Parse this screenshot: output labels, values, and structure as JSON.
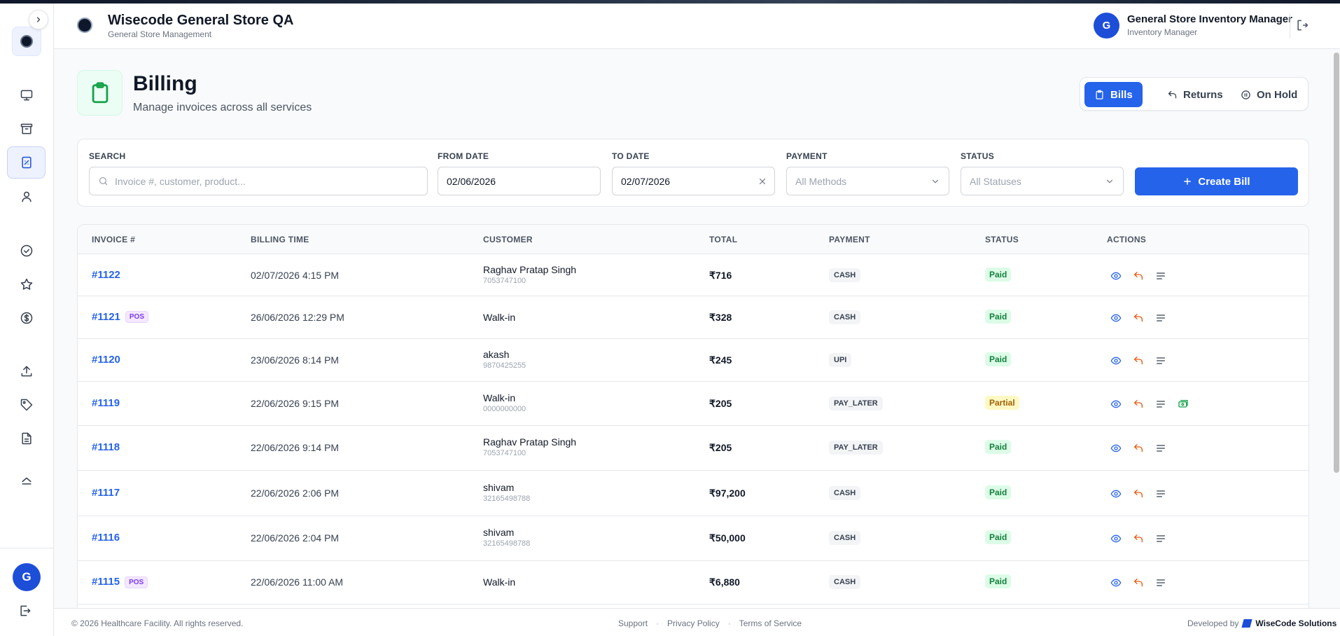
{
  "header": {
    "store_name": "Wisecode General Store QA",
    "store_subtitle": "General Store Management",
    "avatar_initial": "G",
    "user_name": "General Store Inventory Manager",
    "user_role": "Inventory Manager"
  },
  "sidebar": {
    "avatar_initial": "G",
    "items": [
      {
        "icon": "monitor-icon",
        "active": false
      },
      {
        "icon": "archive-icon",
        "active": false
      },
      {
        "icon": "receipt-icon",
        "active": true
      },
      {
        "icon": "user-icon",
        "active": false
      },
      {
        "icon": "check-circle-icon",
        "active": false
      },
      {
        "icon": "star-icon",
        "active": false
      },
      {
        "icon": "dollar-circle-icon",
        "active": false
      },
      {
        "icon": "upload-icon",
        "active": false
      },
      {
        "icon": "tag-icon",
        "active": false
      },
      {
        "icon": "document-icon",
        "active": false
      },
      {
        "icon": "eject-icon",
        "active": false
      }
    ]
  },
  "page": {
    "title": "Billing",
    "subtitle": "Manage invoices across all services",
    "tabs": [
      {
        "label": "Bills",
        "icon": "clipboard-icon",
        "active": true
      },
      {
        "label": "Returns",
        "icon": "return-icon",
        "active": false
      },
      {
        "label": "On Hold",
        "icon": "pause-icon",
        "active": false
      }
    ]
  },
  "filters": {
    "search_label": "SEARCH",
    "search_placeholder": "Invoice #, customer, product...",
    "from_label": "FROM DATE",
    "from_value": "02/06/2026",
    "to_label": "TO DATE",
    "to_value": "02/07/2026",
    "payment_label": "PAYMENT",
    "payment_value": "All Methods",
    "status_label": "STATUS",
    "status_value": "All Statuses",
    "create_label": "Create Bill"
  },
  "table": {
    "columns": [
      "INVOICE #",
      "BILLING TIME",
      "CUSTOMER",
      "TOTAL",
      "PAYMENT",
      "STATUS",
      "ACTIONS"
    ],
    "rows": [
      {
        "invoice": "#1122",
        "pos": false,
        "time": "02/07/2026 4:15 PM",
        "customer": "Raghav Pratap Singh",
        "phone": "7053747100",
        "total": "₹716",
        "payment": "CASH",
        "status": "Paid",
        "extra_action": false
      },
      {
        "invoice": "#1121",
        "pos": true,
        "pos_label": "POS",
        "time": "26/06/2026 12:29 PM",
        "customer": "Walk-in",
        "phone": "",
        "total": "₹328",
        "payment": "CASH",
        "status": "Paid",
        "extra_action": false
      },
      {
        "invoice": "#1120",
        "pos": false,
        "time": "23/06/2026 8:14 PM",
        "customer": "akash",
        "phone": "9870425255",
        "total": "₹245",
        "payment": "UPI",
        "status": "Paid",
        "extra_action": false
      },
      {
        "invoice": "#1119",
        "pos": false,
        "time": "22/06/2026 9:15 PM",
        "customer": "Walk-in",
        "phone": "0000000000",
        "total": "₹205",
        "payment": "PAY_LATER",
        "status": "Partial",
        "extra_action": true
      },
      {
        "invoice": "#1118",
        "pos": false,
        "time": "22/06/2026 9:14 PM",
        "customer": "Raghav Pratap Singh",
        "phone": "7053747100",
        "total": "₹205",
        "payment": "PAY_LATER",
        "status": "Paid",
        "extra_action": false
      },
      {
        "invoice": "#1117",
        "pos": false,
        "time": "22/06/2026 2:06 PM",
        "customer": "shivam",
        "phone": "32165498788",
        "total": "₹97,200",
        "payment": "CASH",
        "status": "Paid",
        "extra_action": false
      },
      {
        "invoice": "#1116",
        "pos": false,
        "time": "22/06/2026 2:04 PM",
        "customer": "shivam",
        "phone": "32165498788",
        "total": "₹50,000",
        "payment": "CASH",
        "status": "Paid",
        "extra_action": false
      },
      {
        "invoice": "#1115",
        "pos": true,
        "pos_label": "POS",
        "time": "22/06/2026 11:00 AM",
        "customer": "Walk-in",
        "phone": "",
        "total": "₹6,880",
        "payment": "CASH",
        "status": "Paid",
        "extra_action": false
      }
    ]
  },
  "footer": {
    "copyright": "© 2026 Healthcare Facility. All rights reserved.",
    "links": [
      "Support",
      "Privacy Policy",
      "Terms of Service"
    ],
    "developed_by": "Developed by",
    "brand": "WiseCode Solutions"
  },
  "colors": {
    "primary": "#2563eb",
    "paid": "#15803d",
    "partial": "#a16207",
    "return_icon": "#ea580c"
  }
}
